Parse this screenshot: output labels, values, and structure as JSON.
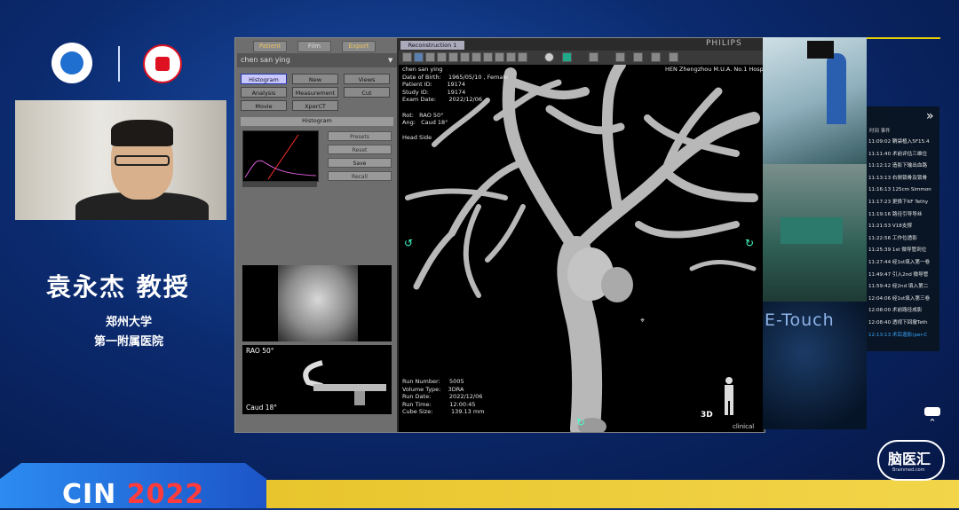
{
  "header": {
    "logo_left": "cin-logo-icon",
    "logo_right": "hospital-seal-icon"
  },
  "speaker": {
    "name": "袁永杰 教授",
    "affiliation_line1": "郑州大学",
    "affiliation_line2": "第一附属医院"
  },
  "app": {
    "tabs": [
      "Patient",
      "Film",
      "Export"
    ],
    "patient_name": "chen san ying",
    "buttons": [
      {
        "label": "Histogram",
        "active": true
      },
      {
        "label": "New",
        "active": false
      },
      {
        "label": "Views",
        "active": false
      },
      {
        "label": "Analysis",
        "active": false
      },
      {
        "label": "Measurement",
        "active": false
      },
      {
        "label": "Cut",
        "active": false
      },
      {
        "label": "Movie",
        "active": false
      },
      {
        "label": "XperCT",
        "active": false
      }
    ],
    "histogram": {
      "title": "Histogram",
      "preset_select": "Presets",
      "reset_label": "Reset",
      "save_label": "Save",
      "recall_label": "Recall"
    },
    "cline": {
      "rao": "RAO   50°",
      "caud": "Caud  18°"
    },
    "viewport_tab": "Reconstruction 1",
    "brand": "PHILIPS",
    "overlay_top_left": "chen san ying\nDate of Birth:    1965/05/10 , Female\nPatient ID:        19174\nStudy ID:          19174\nExam Date:       2022/12/06\n\nRot:   RAO 50°\nAng:   Caud 18°\n\nHead Side",
    "overlay_top_right": "HEN Zhengzhou M.U.A. No.1 Hosp",
    "overlay_bottom_left": "Run Number:     5005\nVolume Type:    3DRA\nRun Date:          2022/12/06\nRun Time:          12:00:45\nCube Size:          139.13 mm",
    "view_mode": "3D",
    "clinical_label": "clinical"
  },
  "right_panel": {
    "etouch_label": "E-Touch",
    "log_header": "时间    事件",
    "log": [
      {
        "text": "11:09:02 鞘袋植入5F15.4",
        "highlight": false
      },
      {
        "text": "11:11:40 术前评估三维位",
        "highlight": false
      },
      {
        "text": "11:12:12 造影下输出血路",
        "highlight": false
      },
      {
        "text": "11:13:13 右侧锁骨及锁骨",
        "highlight": false
      },
      {
        "text": "11:16:13 125cm Simmon",
        "highlight": false
      },
      {
        "text": "11:17:23 更换下6F Tethy",
        "highlight": false
      },
      {
        "text": "11:19:16 路径引导导丝",
        "highlight": false
      },
      {
        "text": "11:21:53 V18支撑",
        "highlight": false
      },
      {
        "text": "11:22:56 工作位透影",
        "highlight": false
      },
      {
        "text": "11:25:39 1st 微导管到位",
        "highlight": false
      },
      {
        "text": "11:27:44 经1st填入第一卷",
        "highlight": false
      },
      {
        "text": "11:49:47 引入2nd 微导管",
        "highlight": false
      },
      {
        "text": "11:59:42 经2nd 填入第二",
        "highlight": false
      },
      {
        "text": "12:04:06 经1st填入第三卷",
        "highlight": false
      },
      {
        "text": "12:08:00 术前路径成影",
        "highlight": false
      },
      {
        "text": "12:08:40 透视下回撤Teth",
        "highlight": false
      },
      {
        "text": "12:13:13 术后造影(per-C",
        "highlight": true
      }
    ]
  },
  "footer": {
    "event_name": "CIN",
    "event_year": "2022",
    "platform_brand": "脑医汇",
    "platform_sub": "Brainmed.com"
  },
  "colors": {
    "background": "#0b2a6e",
    "accent_yellow": "#e7c42b",
    "year_red": "#ff3b3b",
    "highlight_blue": "#39a6ff"
  }
}
